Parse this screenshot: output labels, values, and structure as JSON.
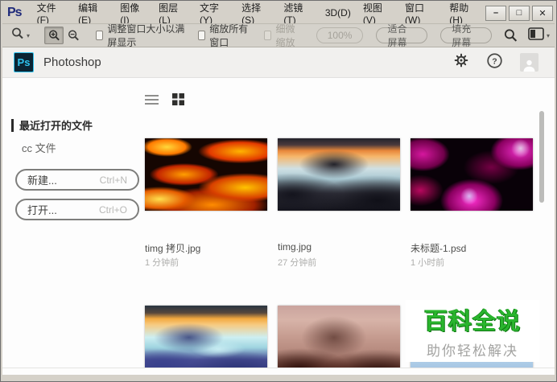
{
  "window": {
    "logo_text": "Ps",
    "menus": [
      "文件(F)",
      "编辑(E)",
      "图像(I)",
      "图层(L)",
      "文字(Y)",
      "选择(S)",
      "滤镜(T)",
      "3D(D)",
      "视图(V)",
      "窗口(W)",
      "帮助(H)"
    ],
    "controls": {
      "minimize": "–",
      "maximize": "□",
      "close": "✕"
    }
  },
  "toolbar": {
    "fit_window_checkbox": "调整窗口大小以满屏显示",
    "zoom_all_windows_checkbox": "缩放所有窗口",
    "scrubby_zoom_checkbox": "细微缩放",
    "percent_button": "100%",
    "fit_screen_button": "适合屏幕",
    "fill_screen_button": "填充屏幕",
    "chevron_down": "▾"
  },
  "home": {
    "header": {
      "app_icon_text": "Ps",
      "title": "Photoshop"
    },
    "sidebar": {
      "recent_files_label": "最近打开的文件",
      "cc_files_label": "cc 文件",
      "new_button": {
        "label": "新建...",
        "shortcut": "Ctrl+N"
      },
      "open_button": {
        "label": "打开...",
        "shortcut": "Ctrl+O"
      }
    },
    "files": [
      {
        "name": "timg 拷贝.jpg",
        "time": "1 分钟前"
      },
      {
        "name": "timg.jpg",
        "time": "27 分钟前"
      },
      {
        "name": "未标题-1.psd",
        "time": "1 小时前"
      }
    ],
    "watermark": {
      "title": "百科全说",
      "subtitle": "助你轻松解决"
    }
  }
}
